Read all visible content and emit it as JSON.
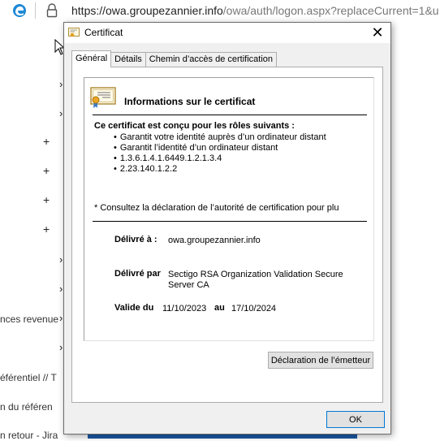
{
  "browser": {
    "url_host": "https://owa.groupezannier.info",
    "url_path": "/owa/auth/logon.aspx?replaceCurrent=1&u"
  },
  "background": {
    "rows": [
      "nces revenue",
      "éférentiel // T",
      "n du référen",
      "n retour - Jira"
    ]
  },
  "dialog": {
    "title": "Certificat",
    "close_symbol": "✕",
    "tabs": [
      "Général",
      "Détails",
      "Chemin d’accès de certification"
    ],
    "info_title": "Informations sur le certificat",
    "roles_title": "Ce certificat est conçu pour les rôles suivants :",
    "roles": [
      "Garantit votre identité auprès d’un ordinateur distant",
      "Garantit l’identité d’un ordinateur distant",
      "1.3.6.1.4.1.6449.1.2.1.3.4",
      "2.23.140.1.2.2"
    ],
    "note": "* Consultez la déclaration de l’autorité de certification pour plu",
    "issued_to_label": "Délivré à :",
    "issued_to_value": "owa.groupezannier.info",
    "issued_by_label": "Délivré par",
    "issued_by_value_line1": "Sectigo RSA Organization Validation Secure",
    "issued_by_value_line2": "Server CA",
    "valid_label": "Valide du",
    "valid_from": "11/10/2023",
    "valid_to_label": "au",
    "valid_to": "17/10/2024",
    "issuer_statement_button": "Déclaration de l’émetteur",
    "ok_button": "OK"
  }
}
